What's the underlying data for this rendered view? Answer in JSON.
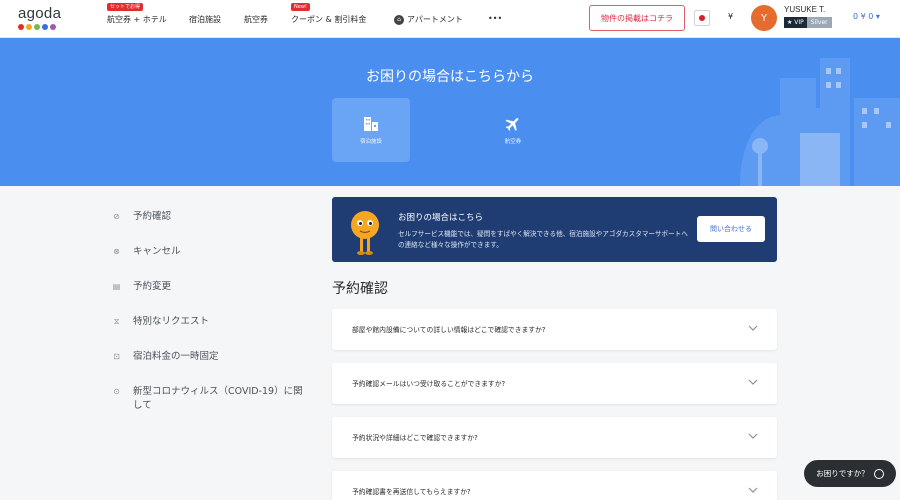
{
  "header": {
    "logo_text": "agoda",
    "logo_colors": [
      "#e12d2d",
      "#f5a623",
      "#7ab648",
      "#3b6fd8",
      "#9b59b6"
    ],
    "nav": [
      {
        "label": "航空券 + ホテル",
        "badge": "セットでお得"
      },
      {
        "label": "宿泊施設"
      },
      {
        "label": "航空券"
      },
      {
        "label": "クーポン & 割引料金",
        "badge": "New!"
      },
      {
        "label": "アパートメント",
        "icon": "apartment-icon"
      },
      {
        "label": "•••"
      }
    ],
    "promo_button": "物件の掲載はコチラ",
    "currency": "¥",
    "avatar_initial": "Y",
    "user_name": "YUSUKE T.",
    "vip": "★ VIP",
    "tier": "Silver",
    "points": "0 ¥ 0 ▾"
  },
  "hero": {
    "title": "お困りの場合はこちらから",
    "tabs": [
      {
        "label": "宿泊施設",
        "icon": "building-icon",
        "active": true
      },
      {
        "label": "航空券",
        "icon": "airplane-icon",
        "active": false
      }
    ],
    "bg_color": "#4a8ef0"
  },
  "sidebar": {
    "items": [
      {
        "label": "予約確認",
        "icon": "check-circle-icon",
        "glyph": "⊘"
      },
      {
        "label": "キャンセル",
        "icon": "cancel-icon",
        "glyph": "⊗"
      },
      {
        "label": "予約変更",
        "icon": "document-icon",
        "glyph": "▤"
      },
      {
        "label": "特別なリクエスト",
        "icon": "request-icon",
        "glyph": "⧖"
      },
      {
        "label": "宿泊料金の一時固定",
        "icon": "lock-icon",
        "glyph": "⊡"
      },
      {
        "label": "新型コロナウィルス（COVID-19）に関して",
        "icon": "covid-icon",
        "glyph": "⊙"
      }
    ]
  },
  "help_card": {
    "title": "お困りの場合はこちら",
    "text": "セルフサービス機能では、疑問をすばやく解決できる他、宿泊施設やアゴダカスタマーサポートへの連絡など様々な操作ができます。",
    "button": "問い合わせる",
    "bg_color": "#1f3d72"
  },
  "section": {
    "heading": "予約確認"
  },
  "faqs": [
    "部屋や館内設備についての詳しい情報はどこで確認できますか?",
    "予約確認メールはいつ受け取ることができますか?",
    "予約状況や詳細はどこで確認できますか?",
    "予約確認書を再送信してもらえますか?"
  ],
  "chat_button": "お困りですか？"
}
